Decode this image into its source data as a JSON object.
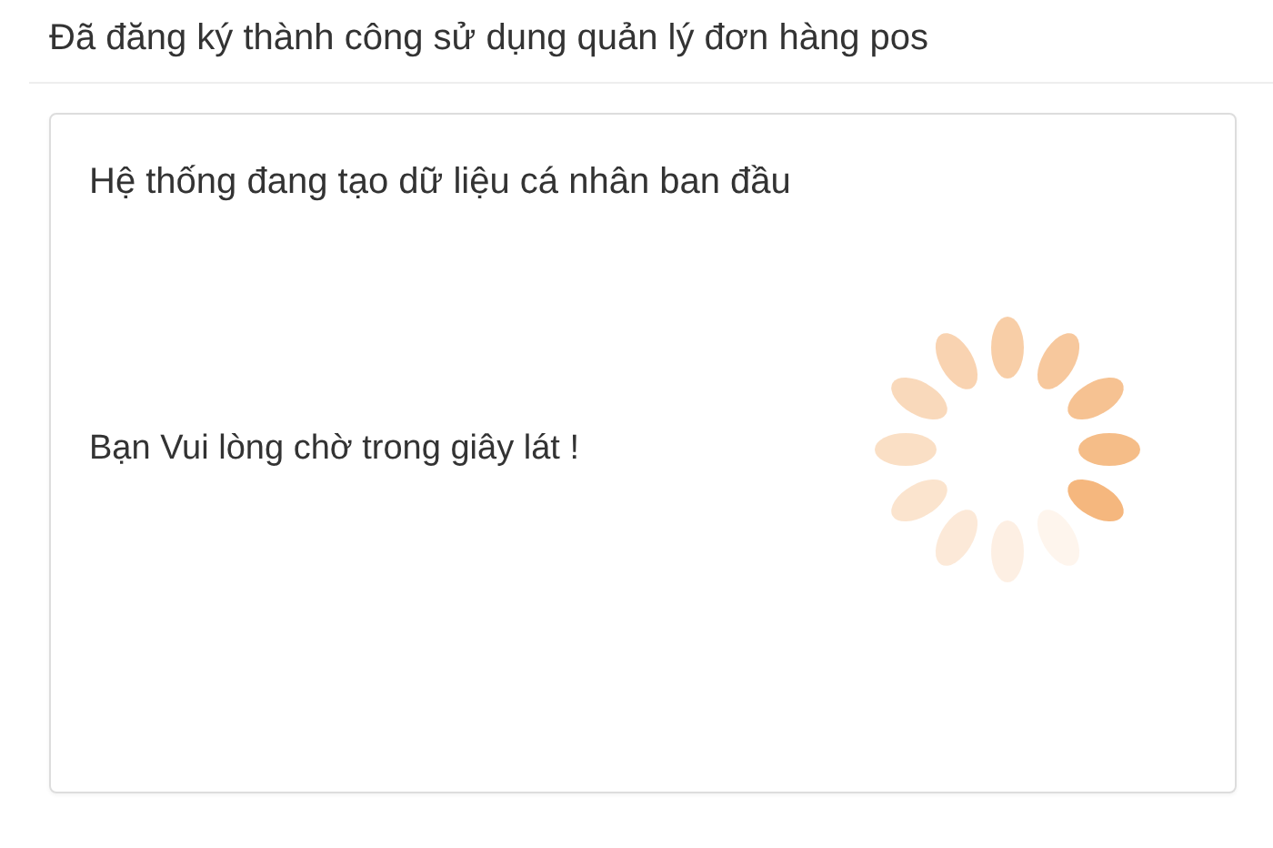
{
  "header": {
    "title": "Đã đăng ký thành công sử dụng quản lý đơn hàng pos"
  },
  "panel": {
    "message": "Hệ thống đang tạo dữ liệu cá nhân ban đầu",
    "wait_text": "Bạn Vui lòng chờ trong giây lát !"
  }
}
